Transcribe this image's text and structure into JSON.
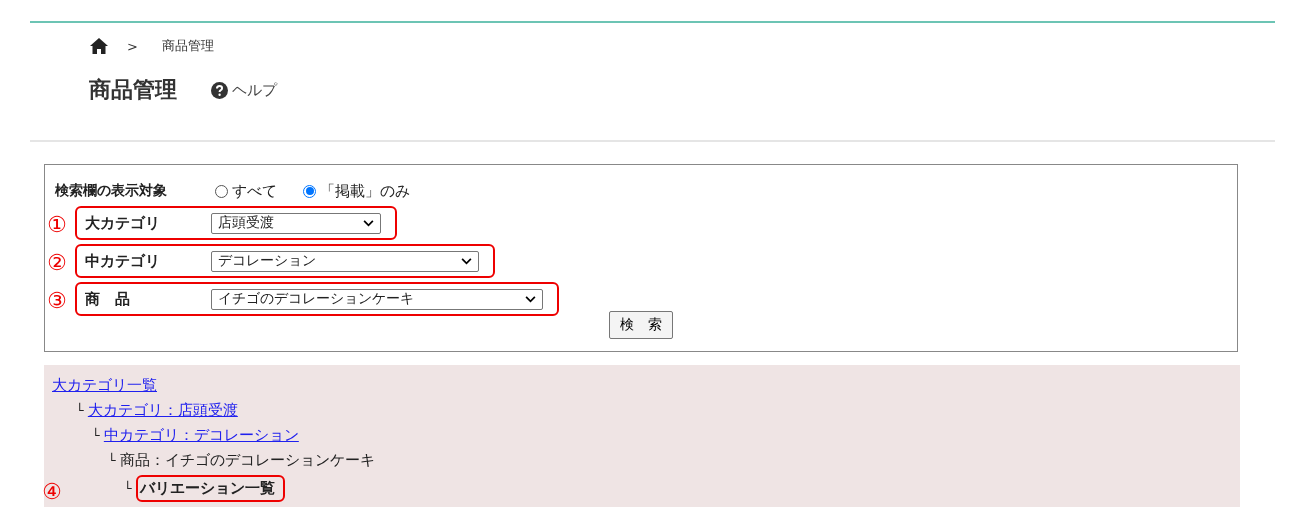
{
  "breadcrumb": {
    "separator": ">",
    "current": "商品管理"
  },
  "page": {
    "title": "商品管理",
    "help": "ヘルプ"
  },
  "search": {
    "display_label": "検索欄の表示対象",
    "display_options": [
      {
        "label": "すべて",
        "selected": false
      },
      {
        "label": "「掲載」のみ",
        "selected": true
      }
    ],
    "fields": [
      {
        "annotation": "①",
        "label": "大カテゴリ",
        "value": "店頭受渡"
      },
      {
        "annotation": "②",
        "label": "中カテゴリ",
        "value": "デコレーション"
      },
      {
        "annotation": "③",
        "label": "商　品",
        "value": "イチゴのデコレーションケーキ"
      }
    ],
    "button": "検　索"
  },
  "tree": [
    {
      "kind": "link",
      "text": "大カテゴリ一覧",
      "children": [
        {
          "kind": "link",
          "marker": "└",
          "text": "大カテゴリ：店頭受渡",
          "children": [
            {
              "kind": "link",
              "marker": "└",
              "text": "中カテゴリ：デコレーション",
              "children": [
                {
                  "kind": "text",
                  "marker": "└",
                  "text": "商品：イチゴのデコレーションケーキ",
                  "children": [
                    {
                      "kind": "current",
                      "marker": "└",
                      "text": "バリエーション一覧",
                      "annotation": "④"
                    }
                  ]
                }
              ]
            }
          ]
        }
      ]
    }
  ]
}
